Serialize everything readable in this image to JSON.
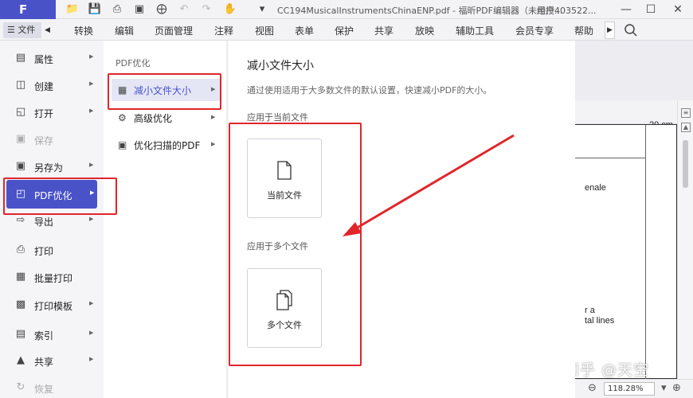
{
  "app": {
    "logo": "F",
    "title": "CC194MusicalInstrumentsChinaENP.pdf - 福昕PDF编辑器（未经授...",
    "user": "用户403522..."
  },
  "menubar": {
    "file_label": "☰ 文件",
    "items": [
      "转换",
      "编辑",
      "页面管理",
      "注释",
      "视图",
      "表单",
      "保护",
      "共享",
      "放映",
      "辅助工具",
      "会员专享",
      "帮助"
    ]
  },
  "file_menu": {
    "items": [
      {
        "label": "属性",
        "icon": "properties-icon",
        "arrow": true
      },
      {
        "label": "创建",
        "icon": "create-icon",
        "arrow": true
      },
      {
        "label": "打开",
        "icon": "open-icon",
        "arrow": true
      },
      {
        "label": "保存",
        "icon": "save-icon",
        "arrow": false,
        "disabled": true
      },
      {
        "label": "另存为",
        "icon": "save-as-icon",
        "arrow": true
      },
      {
        "label": "PDF优化",
        "icon": "pdf-optimize-icon",
        "arrow": true,
        "active": true
      },
      {
        "label": "导出",
        "icon": "export-icon",
        "arrow": true
      },
      {
        "label": "打印",
        "icon": "print-icon",
        "arrow": false
      },
      {
        "label": "批量打印",
        "icon": "batch-print-icon",
        "arrow": false
      },
      {
        "label": "打印模板",
        "icon": "print-template-icon",
        "arrow": true
      },
      {
        "label": "索引",
        "icon": "index-icon",
        "arrow": true
      },
      {
        "label": "共享",
        "icon": "share-icon",
        "arrow": true
      },
      {
        "label": "恢复",
        "icon": "restore-icon",
        "arrow": false,
        "disabled": true
      }
    ]
  },
  "submenu": {
    "title": "PDF优化",
    "items": [
      {
        "label": "减小文件大小",
        "active": true
      },
      {
        "label": "高级优化",
        "active": false
      },
      {
        "label": "优化扫描的PDF",
        "active": false
      }
    ]
  },
  "panel": {
    "title": "减小文件大小",
    "description": "通过使用适用于大多数文件的默认设置，快速减小PDF的大小。",
    "section_current": "应用于当前文件",
    "card_current": "当前文件",
    "section_multi": "应用于多个文件",
    "card_multi": "多个文件"
  },
  "document": {
    "ruler_label": "20 cm",
    "text_1": "enale",
    "text_2": "r a",
    "text_3": "tal lines",
    "zoom": "118.28%"
  },
  "watermark": "知乎 @天空",
  "colors": {
    "accent": "#4a52c8",
    "annotation_red": "#e0262b"
  }
}
